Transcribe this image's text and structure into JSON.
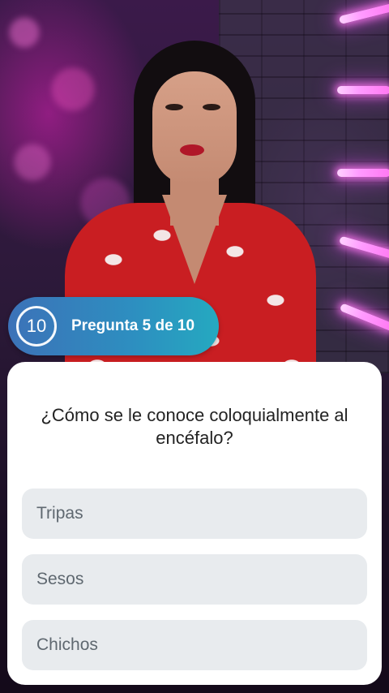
{
  "quiz": {
    "timer_value": "10",
    "progress_label": "Pregunta 5 de 10",
    "question": "¿Cómo se le conoce coloquialmente al encéfalo?",
    "options": [
      {
        "label": "Tripas"
      },
      {
        "label": "Sesos"
      },
      {
        "label": "Chichos"
      }
    ]
  },
  "theme": {
    "pill_gradient_start": "#3c72b8",
    "pill_gradient_end": "#25a9c0",
    "card_background": "#ffffff",
    "option_background": "#e8ebee",
    "option_text": "#5f6870",
    "question_text": "#222222"
  }
}
